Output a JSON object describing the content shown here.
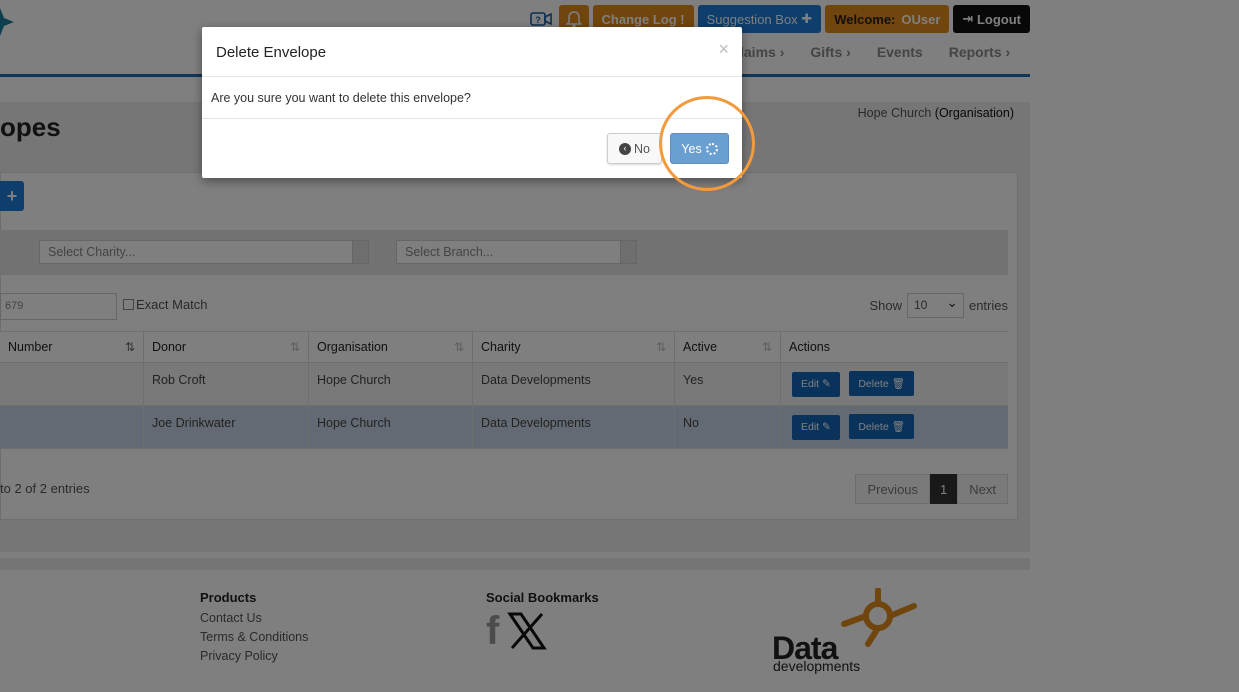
{
  "topbar": {
    "change_log": "Change Log",
    "suggestion_box": "Suggestion Box",
    "welcome": "Welcome:",
    "user": "OUser",
    "logout": "Logout"
  },
  "nav": {
    "items": [
      "laims ›",
      "Gifts ›",
      "Events",
      "Reports ›"
    ]
  },
  "page": {
    "org_name": "Hope Church",
    "org_type": "(Organisation)",
    "title": "opes"
  },
  "filters": {
    "charity_placeholder": "Select Charity...",
    "branch_placeholder": "Select Branch...",
    "search_value": "679",
    "exact_match": "Exact Match",
    "show_label": "Show",
    "entries_value": "10",
    "entries_label": "entries"
  },
  "table": {
    "headers": [
      "Number",
      "Donor",
      "Organisation",
      "Charity",
      "Active",
      "Actions"
    ],
    "rows": [
      {
        "number": "",
        "donor": "Rob Croft",
        "organisation": "Hope Church",
        "charity": "Data Developments",
        "active": "Yes"
      },
      {
        "number": "",
        "donor": "Joe Drinkwater",
        "organisation": "Hope Church",
        "charity": "Data Developments",
        "active": "No"
      }
    ],
    "edit_label": "Edit",
    "delete_label": "Delete"
  },
  "pagination": {
    "summary": "to 2 of 2 entries",
    "previous": "Previous",
    "current": "1",
    "next": "Next"
  },
  "footer": {
    "products_heading": "Products",
    "links": [
      "Contact Us",
      "Terms & Conditions",
      "Privacy Policy"
    ],
    "social_heading": "Social Bookmarks",
    "brand_word": "Data",
    "brand_sub": "developments"
  },
  "modal": {
    "title": "Delete Envelope",
    "close": "×",
    "message": "Are you sure you want to delete this envelope?",
    "no_label": "No",
    "yes_label": "Yes"
  },
  "colors": {
    "accent_blue": "#1a7cd8",
    "accent_orange": "#e08a1d",
    "highlight_ring": "#f39a3d"
  }
}
